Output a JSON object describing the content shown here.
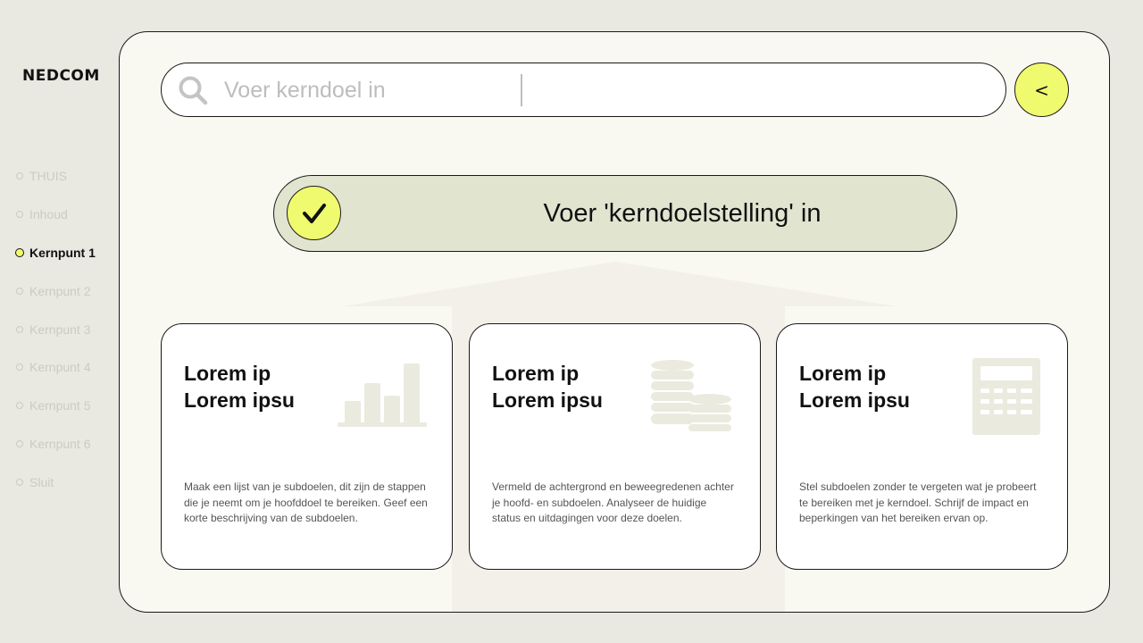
{
  "brand": "NEDCOM",
  "nav": {
    "items": [
      {
        "label": "THUIS",
        "active": false
      },
      {
        "label": "Inhoud",
        "active": false
      },
      {
        "label": "Kernpunt 1",
        "active": true
      },
      {
        "label": "Kernpunt 2",
        "active": false
      },
      {
        "label": "Kernpunt 3",
        "active": false
      },
      {
        "label": "Kernpunt 4",
        "active": false
      },
      {
        "label": "Kernpunt 5",
        "active": false
      },
      {
        "label": "Kernpunt 6",
        "active": false
      },
      {
        "label": "Sluit",
        "active": false
      }
    ]
  },
  "search": {
    "placeholder": "Voer kerndoel in",
    "value": ""
  },
  "back_button": {
    "label": "<"
  },
  "goal": {
    "text": "Voer 'kerndoelstelling' in"
  },
  "cards": [
    {
      "title_line1": "Lorem ip",
      "title_line2": "Lorem ipsu",
      "description": "Maak een lijst van je subdoelen, dit zijn de stappen die je neemt om je hoofddoel te bereiken. Geef een korte beschrijving van de subdoelen.",
      "icon": "bar-chart-icon"
    },
    {
      "title_line1": "Lorem ip",
      "title_line2": "Lorem ipsu",
      "description": "Vermeld de achtergrond en beweegredenen achter je hoofd- en subdoelen. Analyseer de huidige status en uitdagingen voor deze doelen.",
      "icon": "coins-icon"
    },
    {
      "title_line1": "Lorem ip",
      "title_line2": "Lorem ipsu",
      "description": "Stel subdoelen zonder te vergeten wat je probeert te bereiken met je kerndoel. Schrijf de impact en beperkingen van het bereiken ervan op.",
      "icon": "calculator-icon"
    }
  ],
  "colors": {
    "background": "#e9e9e1",
    "panel": "#f9f8f1",
    "accent": "#f0fa6e",
    "goal_bar": "#e1e5d0",
    "muted_icon": "#ebeadf"
  }
}
